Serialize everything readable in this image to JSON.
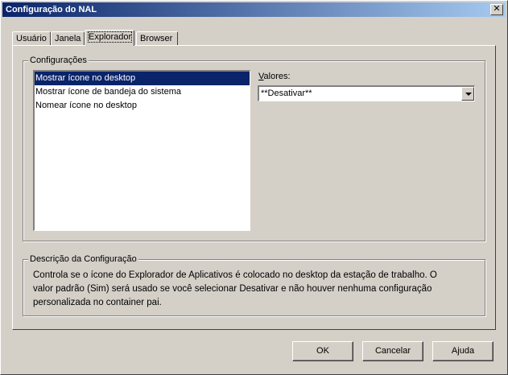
{
  "window": {
    "title": "Configuração do NAL",
    "close_glyph": "✕"
  },
  "tabs": [
    {
      "label": "Usuário"
    },
    {
      "label": "Janela"
    },
    {
      "label": "Explorador",
      "active": true
    },
    {
      "label": "Browser"
    }
  ],
  "config_group": {
    "label": "Configurações"
  },
  "settings_list": [
    {
      "label": "Mostrar ícone no desktop",
      "selected": true
    },
    {
      "label": "Mostrar ícone de bandeja do sistema"
    },
    {
      "label": "Nomear ícone no desktop"
    }
  ],
  "values": {
    "label_accel": "V",
    "label_rest": "alores:",
    "selected": "**Desativar**"
  },
  "description_group": {
    "label": "Descrição da Configuração",
    "lines": [
      "Controla se o ícone do Explorador de Aplicativos é colocado no desktop da estação de trabalho. O",
      "valor padrão (Sim) será usado se você selecionar Desativar e não houver nenhuma configuração",
      "personalizada no container pai."
    ]
  },
  "buttons": {
    "ok": "OK",
    "cancel": "Cancelar",
    "help": "Ajuda"
  }
}
